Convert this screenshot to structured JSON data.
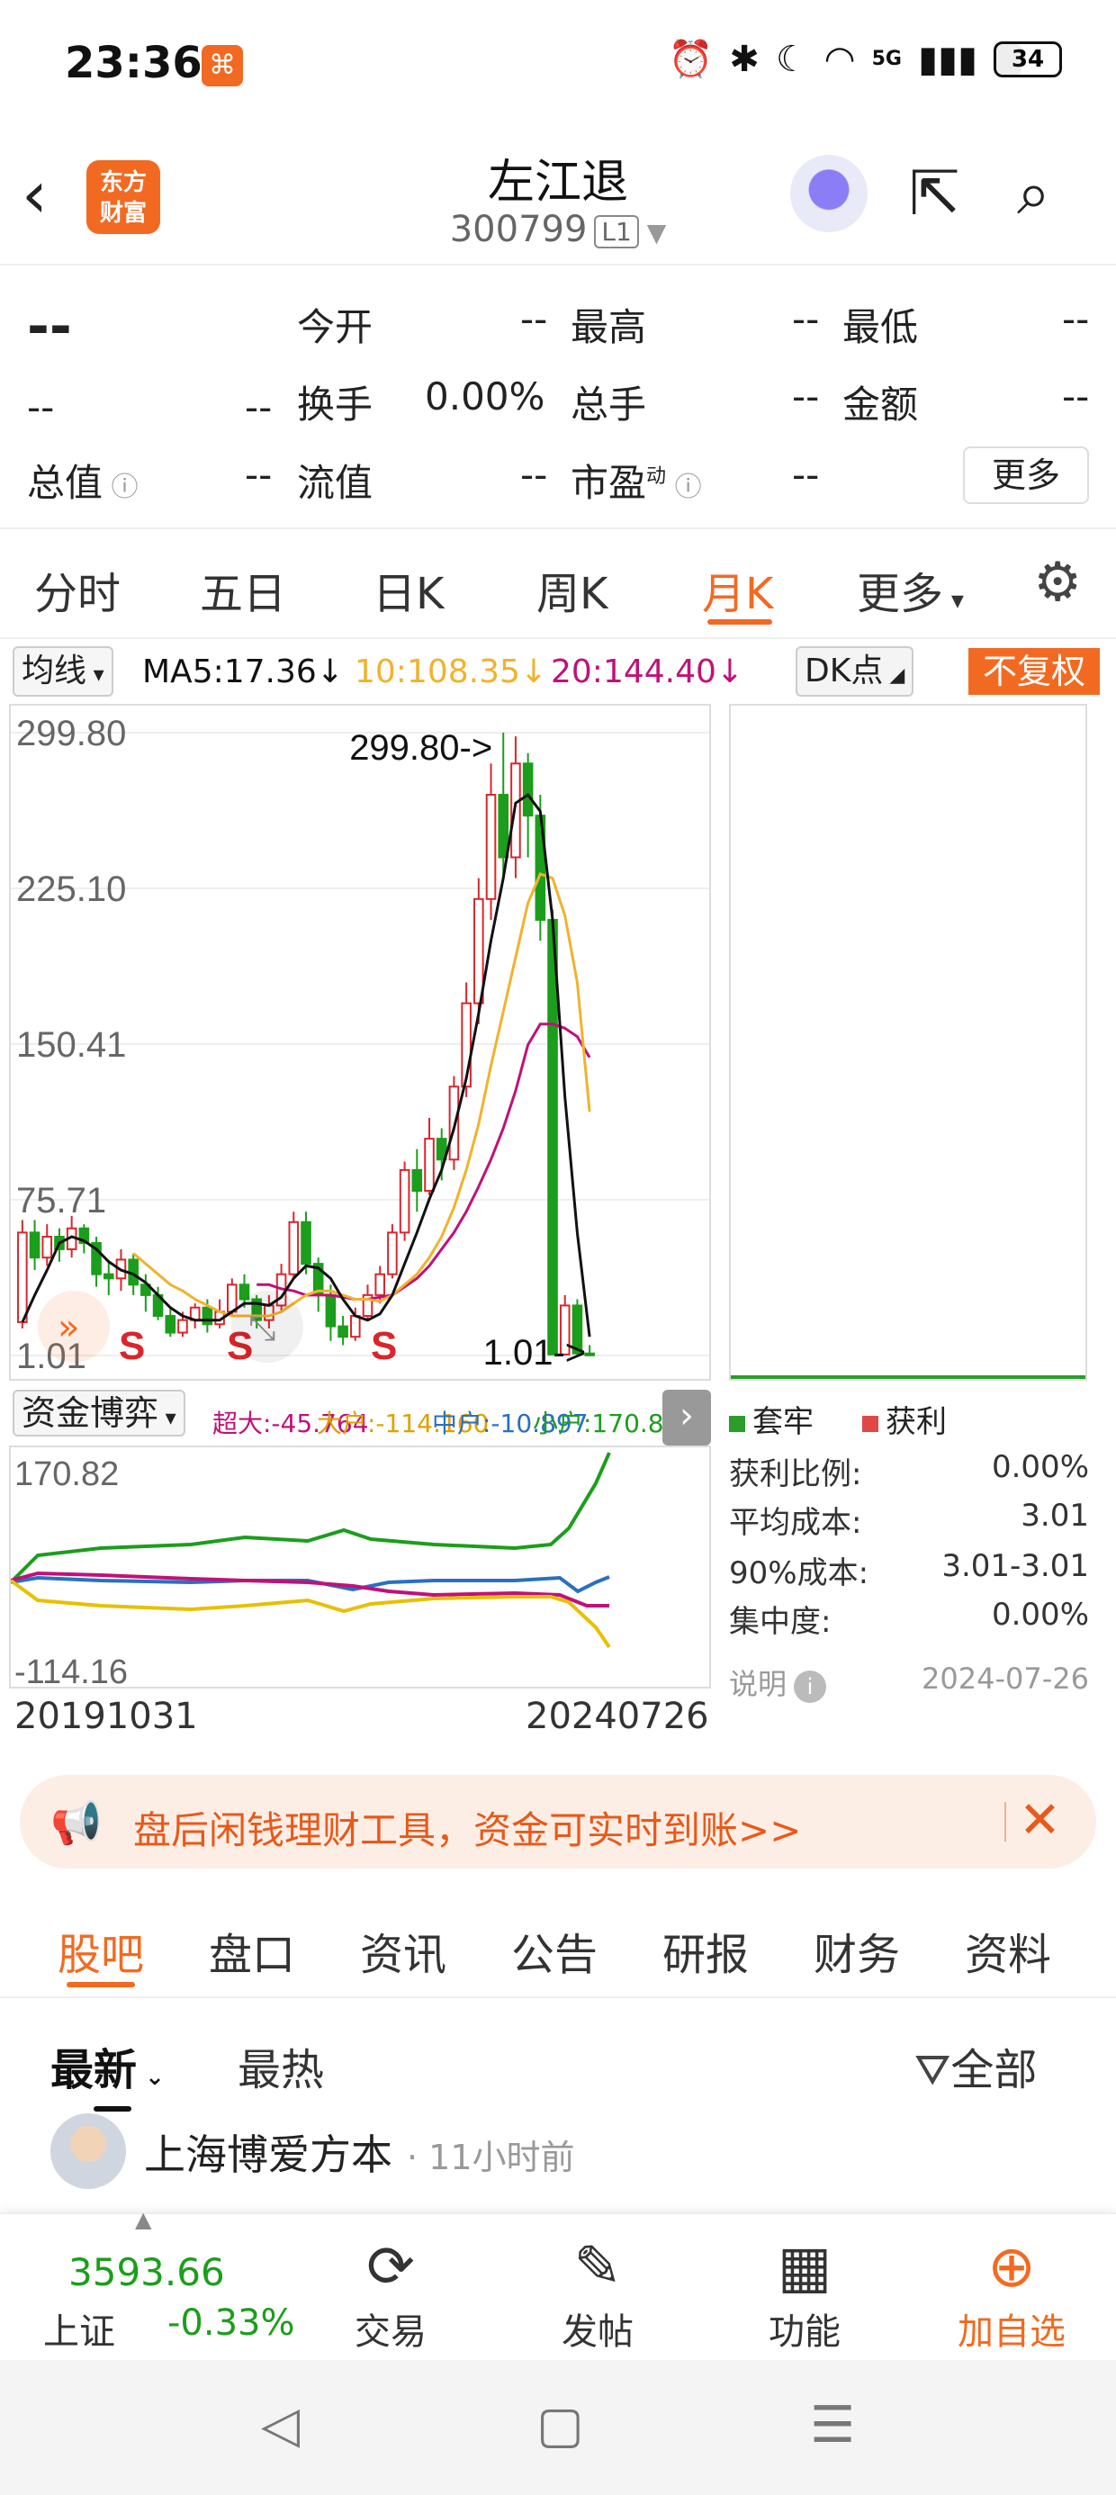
{
  "status": {
    "time": "23:36",
    "battery": "34",
    "network": "5G"
  },
  "header": {
    "title": "左江退",
    "code": "300799",
    "level": "L1",
    "logo_line1": "东方",
    "logo_line2": "财富"
  },
  "quote": {
    "price": "--",
    "change": "--",
    "change_pct": "--",
    "open_label": "今开",
    "open": "--",
    "high_label": "最高",
    "high": "--",
    "low_label": "最低",
    "low": "--",
    "turnover_label": "换手",
    "turnover": "0.00%",
    "volume_label": "总手",
    "volume": "--",
    "amount_label": "金额",
    "amount": "--",
    "mktcap_label": "总值",
    "mktcap": "--",
    "float_label": "流值",
    "float": "--",
    "pe_label": "市盈",
    "pe_sup": "动",
    "pe": "--",
    "more": "更多"
  },
  "tabs": [
    "分时",
    "五日",
    "日K",
    "周K",
    "月K",
    "更多"
  ],
  "active_tab": "月K",
  "ma": {
    "select": "均线",
    "ma5": "MA5:17.36",
    "ma10": "10:108.35",
    "ma20": "20:144.40",
    "dk": "DK点",
    "fq": "不复权"
  },
  "axis": {
    "y1": "299.80",
    "y2": "225.10",
    "y3": "150.41",
    "y4": "75.71",
    "y5": "1.01",
    "max_label": "299.80->",
    "min_label": "1.01->"
  },
  "signals": [
    "S",
    "S",
    "S"
  ],
  "fund": {
    "select": "资金博弈",
    "super": "超大:-45.764",
    "big": "大户:-114.160",
    "mid": "中户:-10.897",
    "small": "小户:170.821",
    "y_top": "170.82",
    "y_bottom": "-114.16"
  },
  "dates": {
    "start": "20191031",
    "end": "20240726"
  },
  "chips": {
    "legend_trap": "套牢",
    "legend_profit": "获利",
    "profit_ratio_label": "获利比例:",
    "profit_ratio": "0.00%",
    "avg_cost_label": "平均成本:",
    "avg_cost": "3.01",
    "cost90_label": "90%成本:",
    "cost90": "3.01-3.01",
    "concentration_label": "集中度:",
    "concentration": "0.00%",
    "note_label": "说明",
    "date": "2024-07-26"
  },
  "banner": {
    "text": "盘后闲钱理财工具，资金可实时到账>>"
  },
  "subtabs": [
    "股吧",
    "盘口",
    "资讯",
    "公告",
    "研报",
    "财务",
    "资料"
  ],
  "filter": {
    "latest": "最新",
    "hot": "最热",
    "all": "全部"
  },
  "post": {
    "author": "上海博爱方本",
    "time": "· 11小时前"
  },
  "index": {
    "value": "3593.66",
    "name": "上证",
    "change": "-0.33%"
  },
  "bottom": [
    {
      "label": "交易",
      "icon": "trade-icon"
    },
    {
      "label": "发帖",
      "icon": "edit-icon"
    },
    {
      "label": "功能",
      "icon": "grid-icon"
    },
    {
      "label": "加自选",
      "icon": "plus-circle-icon"
    }
  ],
  "colors": {
    "accent": "#f26a21",
    "up": "#d9262c",
    "down": "#1b9e1b",
    "ma5": "#111111",
    "ma10": "#f1b22d",
    "ma20": "#c0117a"
  },
  "chart_data": {
    "type": "candlestick",
    "period": "monthly",
    "ylim": [
      1.01,
      299.8
    ],
    "ticks": [
      299.8,
      225.1,
      150.41,
      75.71,
      1.01
    ],
    "candles": [
      [
        17,
        60,
        66,
        14
      ],
      [
        60,
        48,
        66,
        42
      ],
      [
        48,
        58,
        64,
        44
      ],
      [
        58,
        52,
        62,
        46
      ],
      [
        52,
        62,
        68,
        48
      ],
      [
        62,
        55,
        64,
        50
      ],
      [
        55,
        40,
        58,
        34
      ],
      [
        40,
        38,
        46,
        30
      ],
      [
        38,
        47,
        52,
        32
      ],
      [
        47,
        35,
        50,
        30
      ],
      [
        35,
        30,
        40,
        22
      ],
      [
        30,
        20,
        34,
        18
      ],
      [
        20,
        12,
        24,
        10
      ],
      [
        12,
        18,
        22,
        10
      ],
      [
        18,
        24,
        26,
        14
      ],
      [
        24,
        16,
        28,
        12
      ],
      [
        16,
        22,
        28,
        14
      ],
      [
        22,
        35,
        38,
        20
      ],
      [
        35,
        28,
        40,
        24
      ],
      [
        28,
        18,
        30,
        14
      ],
      [
        18,
        25,
        30,
        14
      ],
      [
        25,
        40,
        45,
        22
      ],
      [
        40,
        65,
        70,
        38
      ],
      [
        65,
        45,
        70,
        40
      ],
      [
        45,
        30,
        48,
        22
      ],
      [
        30,
        15,
        35,
        8
      ],
      [
        15,
        10,
        20,
        6
      ],
      [
        10,
        20,
        24,
        8
      ],
      [
        20,
        30,
        35,
        18
      ],
      [
        30,
        40,
        44,
        26
      ],
      [
        40,
        60,
        64,
        38
      ],
      [
        60,
        90,
        94,
        56
      ],
      [
        90,
        80,
        100,
        70
      ],
      [
        80,
        105,
        115,
        78
      ],
      [
        105,
        95,
        110,
        85
      ],
      [
        95,
        130,
        135,
        90
      ],
      [
        130,
        170,
        180,
        125
      ],
      [
        170,
        220,
        230,
        160
      ],
      [
        220,
        270,
        285,
        210
      ],
      [
        270,
        240,
        299.8,
        230
      ],
      [
        240,
        285,
        298,
        230
      ],
      [
        285,
        260,
        290,
        240
      ],
      [
        260,
        210,
        270,
        200
      ],
      [
        210,
        1.5,
        215,
        1.2
      ],
      [
        1.5,
        25,
        30,
        1.1
      ],
      [
        25,
        2,
        28,
        1.01
      ],
      [
        2,
        1.1,
        6,
        1.01
      ]
    ],
    "ma5": [
      17,
      30,
      42,
      55,
      58,
      56,
      52,
      46,
      42,
      40,
      36,
      30,
      24,
      20,
      18,
      18,
      18,
      22,
      26,
      26,
      25,
      29,
      38,
      44,
      43,
      38,
      28,
      20,
      18,
      21,
      30,
      45,
      60,
      76,
      90,
      110,
      134,
      165,
      200,
      230,
      266,
      270,
      262,
      210,
      125,
      60,
      10
    ],
    "ma10": [
      null,
      null,
      null,
      null,
      null,
      null,
      null,
      null,
      null,
      50,
      45,
      40,
      35,
      32,
      28,
      25,
      22,
      20,
      20,
      20,
      20,
      22,
      26,
      30,
      32,
      32,
      30,
      28,
      28,
      27,
      30,
      35,
      40,
      48,
      58,
      72,
      90,
      112,
      140,
      166,
      192,
      218,
      232,
      230,
      212,
      180,
      118
    ],
    "ma20": [
      null,
      null,
      null,
      null,
      null,
      null,
      null,
      null,
      null,
      null,
      null,
      null,
      null,
      null,
      null,
      null,
      null,
      null,
      null,
      35,
      35,
      33,
      32,
      30,
      30,
      30,
      29,
      28,
      28,
      29,
      30,
      34,
      38,
      44,
      52,
      60,
      70,
      82,
      95,
      110,
      128,
      150,
      160,
      160,
      158,
      154,
      144
    ]
  }
}
